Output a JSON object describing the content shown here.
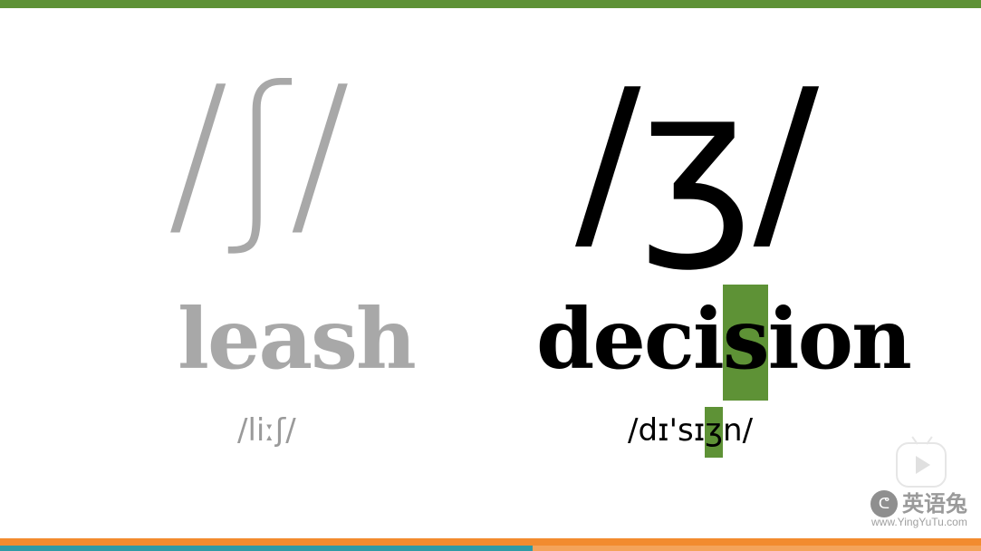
{
  "lesson": {
    "left": {
      "phoneme": "/ʃ/",
      "word": "leash",
      "ipa": "/liːʃ/"
    },
    "right": {
      "phoneme": "/ʒ/",
      "word_before": "deci",
      "word_highlight": "s",
      "word_after": "ion",
      "ipa_before": "/dɪ'sɪ",
      "ipa_highlight": "ʒ",
      "ipa_after": "n/"
    }
  },
  "watermark": {
    "logo_glyph": "ᕦ",
    "brand_name": "英语兔",
    "url": "www.YingYuTu.com",
    "play_icon": "play-icon"
  },
  "colors": {
    "accent_green": "#5e9236",
    "inactive_gray": "#a8a8a8",
    "bar_orange": "#f28b2f",
    "progress_teal": "#2f9aa6"
  },
  "progress": 0.543
}
